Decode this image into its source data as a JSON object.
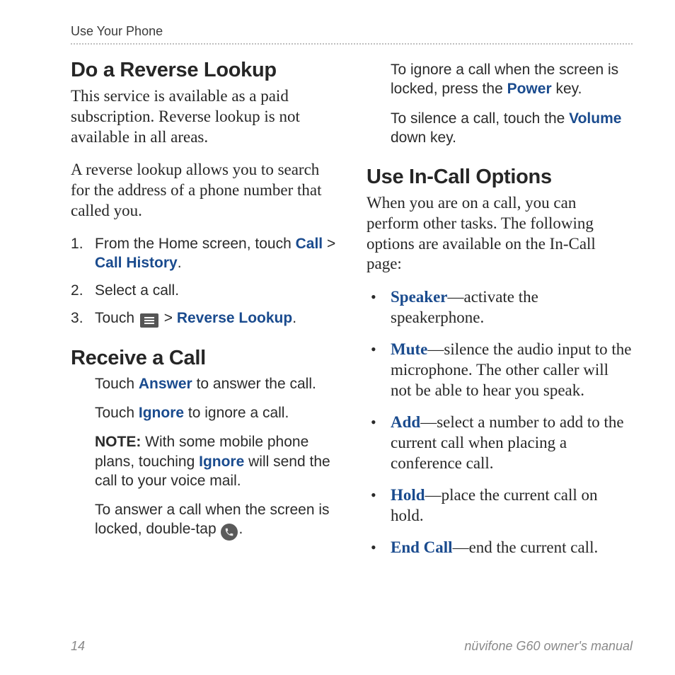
{
  "header": {
    "section": "Use Your Phone"
  },
  "left": {
    "h1": "Do a Reverse Lookup",
    "p1": "This service is available as a paid subscription. Reverse lookup is not available in all areas.",
    "p2": "A reverse lookup allows you to search for the address of a phone number that called you.",
    "steps": {
      "s1_a": "From the Home screen, touch ",
      "s1_call": "Call",
      "s1_gt": " > ",
      "s1_history": "Call History",
      "s1_end": ".",
      "s2": "Select a call.",
      "s3_a": "Touch ",
      "s3_gt": " > ",
      "s3_rl": "Reverse Lookup",
      "s3_end": "."
    },
    "h2": "Receive a Call",
    "r1_a": "Touch ",
    "r1_answer": "Answer",
    "r1_b": " to answer the call.",
    "r2_a": "Touch ",
    "r2_ignore": "Ignore",
    "r2_b": " to ignore a call.",
    "r3_note": "NOTE:",
    "r3_a": " With some mobile phone plans, touching ",
    "r3_ignore": "Ignore",
    "r3_b": " will send the call to your voice mail.",
    "r4_a": "To answer a call when the screen is locked, double-tap ",
    "r4_b": "."
  },
  "right": {
    "p1_a": "To ignore a call when the screen is locked, press the ",
    "p1_power": "Power",
    "p1_b": " key.",
    "p2_a": "To silence a call, touch the ",
    "p2_vol": "Volume",
    "p2_b": " down key.",
    "h1": "Use In-Call Options",
    "intro": "When you are on a call, you can perform other tasks. The following options are available on the In-Call page:",
    "items": {
      "i1_k": "Speaker",
      "i1_v": "—activate the speakerphone.",
      "i2_k": "Mute",
      "i2_v": "—silence the audio input to the microphone. The other caller will not be able to hear you speak.",
      "i3_k": "Add",
      "i3_v": "—select a number to add to the current call when placing a conference call.",
      "i4_k": "Hold",
      "i4_v": "—place the current call on hold.",
      "i5_k": "End Call",
      "i5_v": "—end the current call."
    }
  },
  "footer": {
    "page": "14",
    "title": "nüvifone G60 owner's manual"
  }
}
